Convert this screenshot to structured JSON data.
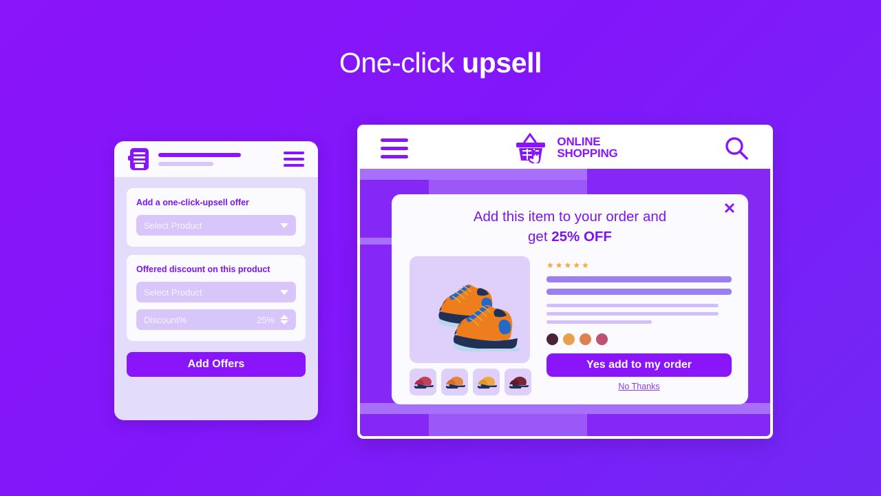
{
  "page": {
    "title_prefix": "One-click ",
    "title_bold": "upsell",
    "background_color": "#8a14fa",
    "accent_color": "#8a14fa"
  },
  "admin_panel": {
    "header": {
      "doc_icon": "document-icon",
      "menu_icon": "hamburger-menu-icon"
    },
    "offer_card": {
      "title": "Add a one-click-upsell offer",
      "product_select": {
        "value": "Select Product",
        "chevron": "chevron-down-icon"
      }
    },
    "discount_card": {
      "title": "Offered discount on this product",
      "product_select": {
        "value": "Select Product",
        "chevron": "chevron-down-icon"
      },
      "discount_field": {
        "label": "Discount%",
        "value": "25%",
        "stepper": "up-down-stepper-icon"
      }
    },
    "submit_button": "Add Offers"
  },
  "browser": {
    "header": {
      "menu_icon": "hamburger-menu-icon",
      "logo": {
        "icon": "shopping-basket-cursor-icon",
        "line1": "ONLINE",
        "line2": "SHOPPING"
      },
      "search_icon": "search-icon"
    },
    "modal": {
      "close_icon": "close-icon",
      "headline_part1": "Add this item to your order and",
      "headline_part2_prefix": "get ",
      "headline_part2_bold": "25% OFF",
      "product_image": "sneakers-orange-blue-image",
      "thumbnails": [
        {
          "name": "thumbnail-shoe-red",
          "color": "#c0415c"
        },
        {
          "name": "thumbnail-shoe-orange",
          "color": "#e8833c"
        },
        {
          "name": "thumbnail-shoe-amber",
          "color": "#f0a63e"
        },
        {
          "name": "thumbnail-shoe-maroon",
          "color": "#7a2436"
        }
      ],
      "rating": {
        "stars": "★★★★★",
        "count": 5
      },
      "text_bars": [
        {
          "width": "100%",
          "kind": "thick"
        },
        {
          "width": "100%",
          "kind": "thick"
        },
        {
          "width": "93%",
          "kind": "thin"
        },
        {
          "width": "93%",
          "kind": "thin"
        },
        {
          "width": "57%",
          "kind": "thin"
        }
      ],
      "color_swatches": [
        {
          "name": "swatch-dark-plum",
          "color": "#4b2336"
        },
        {
          "name": "swatch-orange",
          "color": "#e8a04f"
        },
        {
          "name": "swatch-salmon",
          "color": "#dd8152"
        },
        {
          "name": "swatch-rose",
          "color": "#c05070"
        }
      ],
      "cta_label": "Yes add to my order",
      "decline_label": "No Thanks"
    }
  }
}
